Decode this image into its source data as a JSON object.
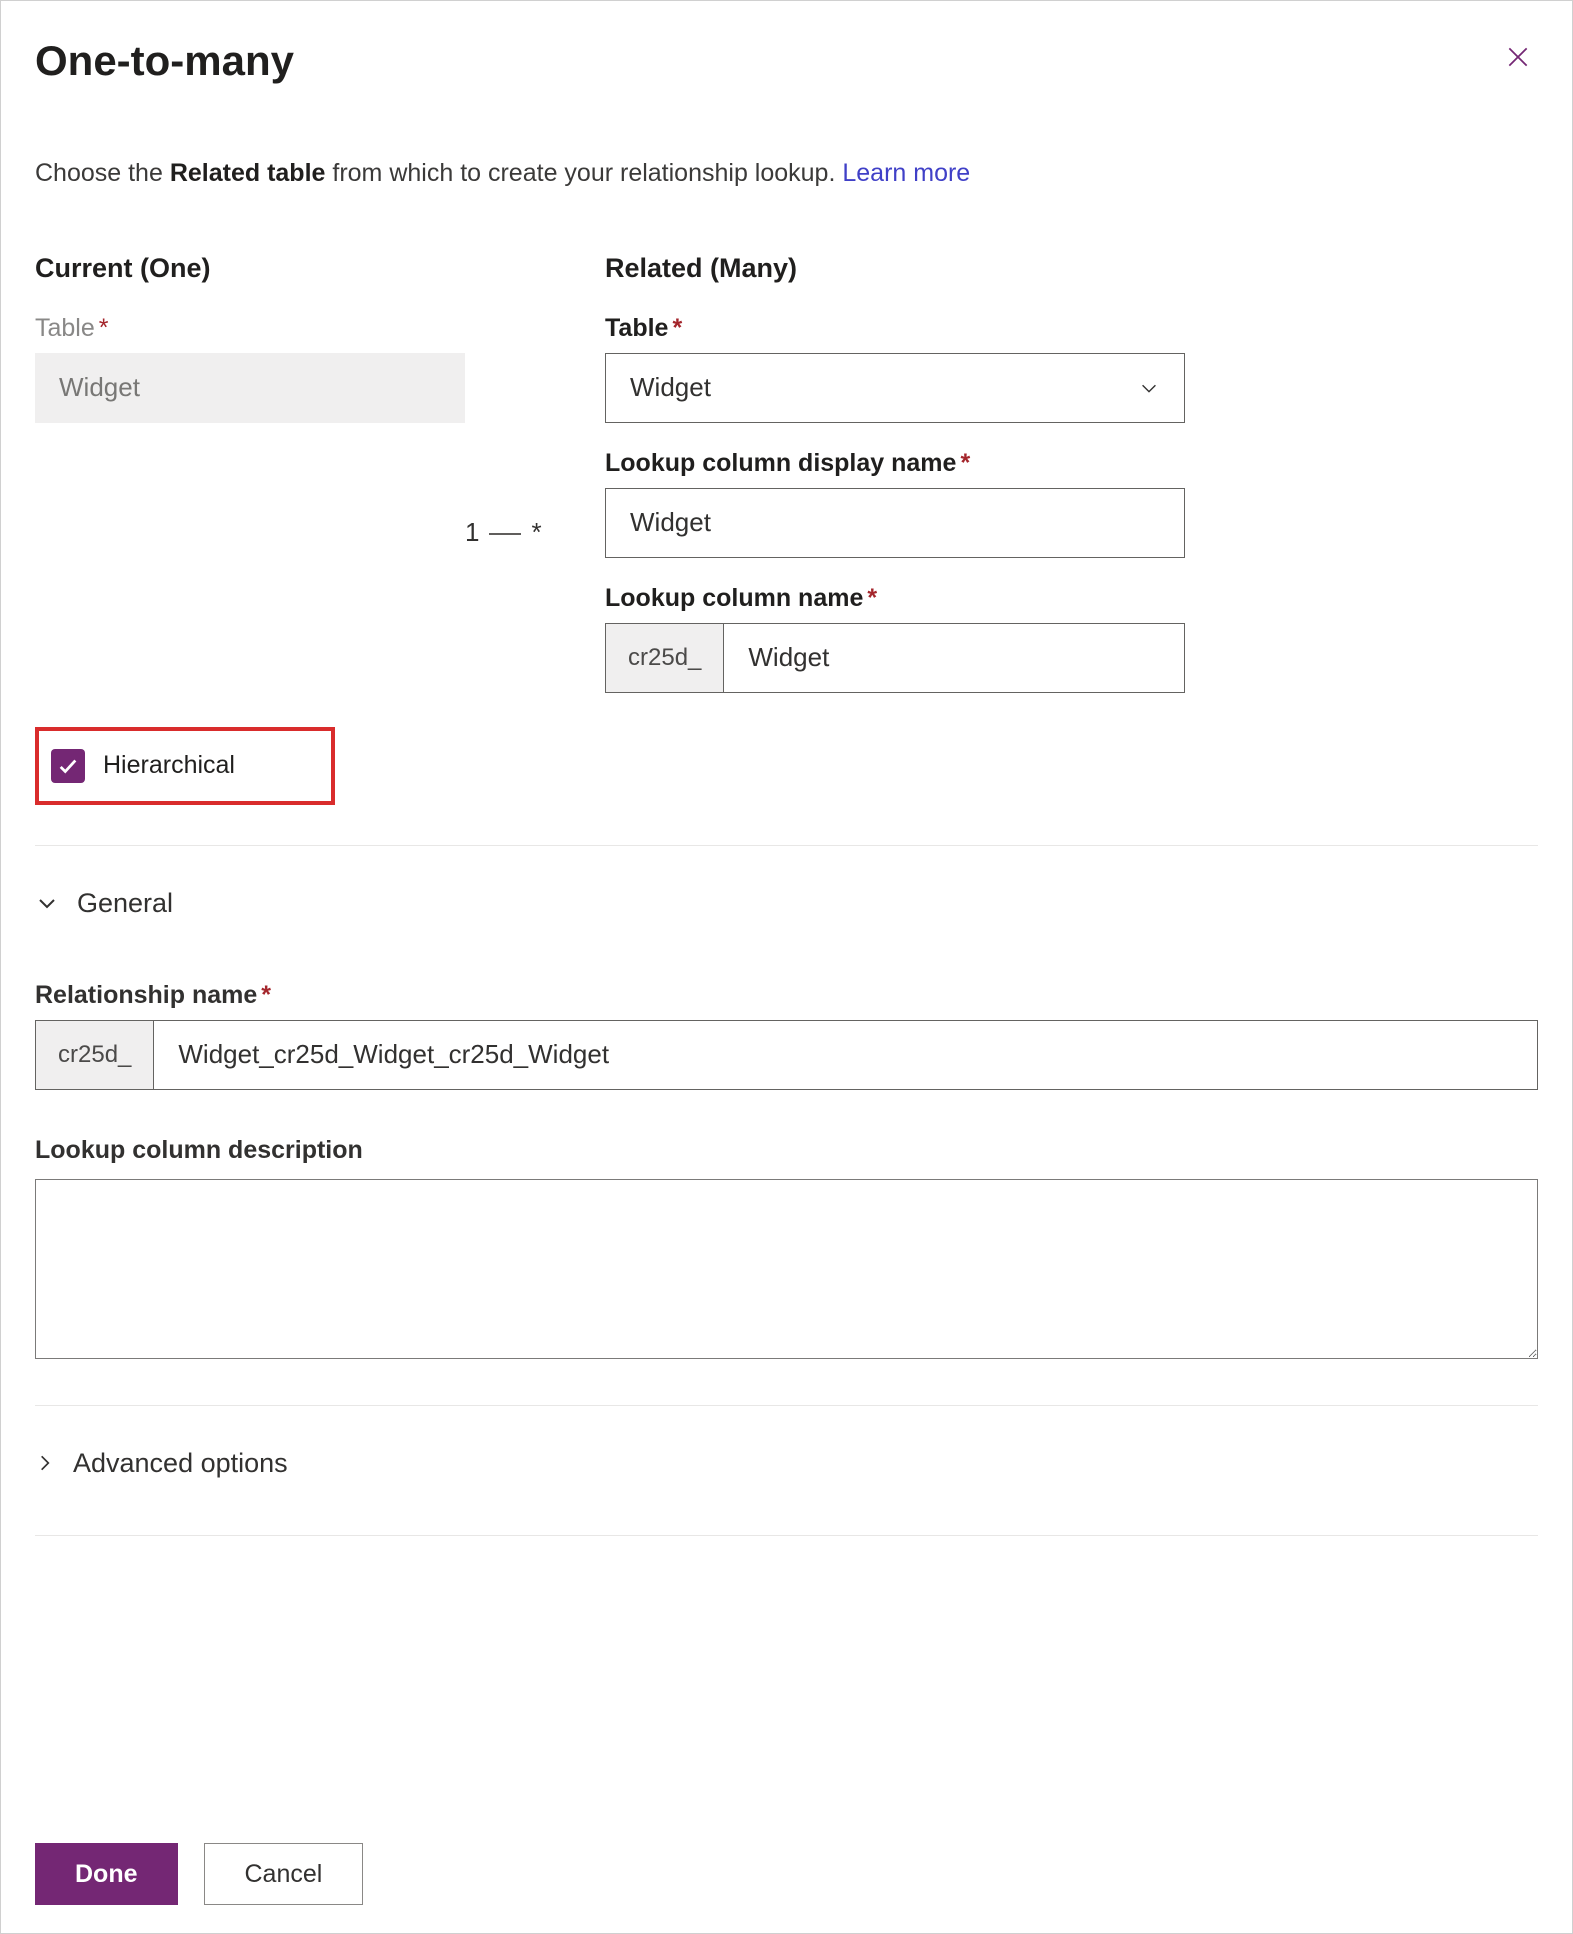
{
  "header": {
    "title": "One-to-many"
  },
  "intro": {
    "prefix": "Choose the ",
    "bold": "Related table",
    "suffix": " from which to create your relationship lookup. ",
    "link": "Learn more"
  },
  "current": {
    "heading": "Current (One)",
    "table_label": "Table",
    "table_value": "Widget"
  },
  "connector": {
    "left": "1",
    "right": "*"
  },
  "related": {
    "heading": "Related (Many)",
    "table_label": "Table",
    "table_value": "Widget",
    "lookup_display_label": "Lookup column display name",
    "lookup_display_value": "Widget",
    "lookup_name_label": "Lookup column name",
    "lookup_name_prefix": "cr25d_",
    "lookup_name_value": "Widget"
  },
  "hierarchical": {
    "label": "Hierarchical",
    "checked": true
  },
  "general": {
    "heading": "General",
    "rel_name_label": "Relationship name",
    "rel_name_prefix": "cr25d_",
    "rel_name_value": "Widget_cr25d_Widget_cr25d_Widget",
    "lookup_desc_label": "Lookup column description",
    "lookup_desc_value": ""
  },
  "advanced": {
    "heading": "Advanced options"
  },
  "footer": {
    "done": "Done",
    "cancel": "Cancel"
  }
}
